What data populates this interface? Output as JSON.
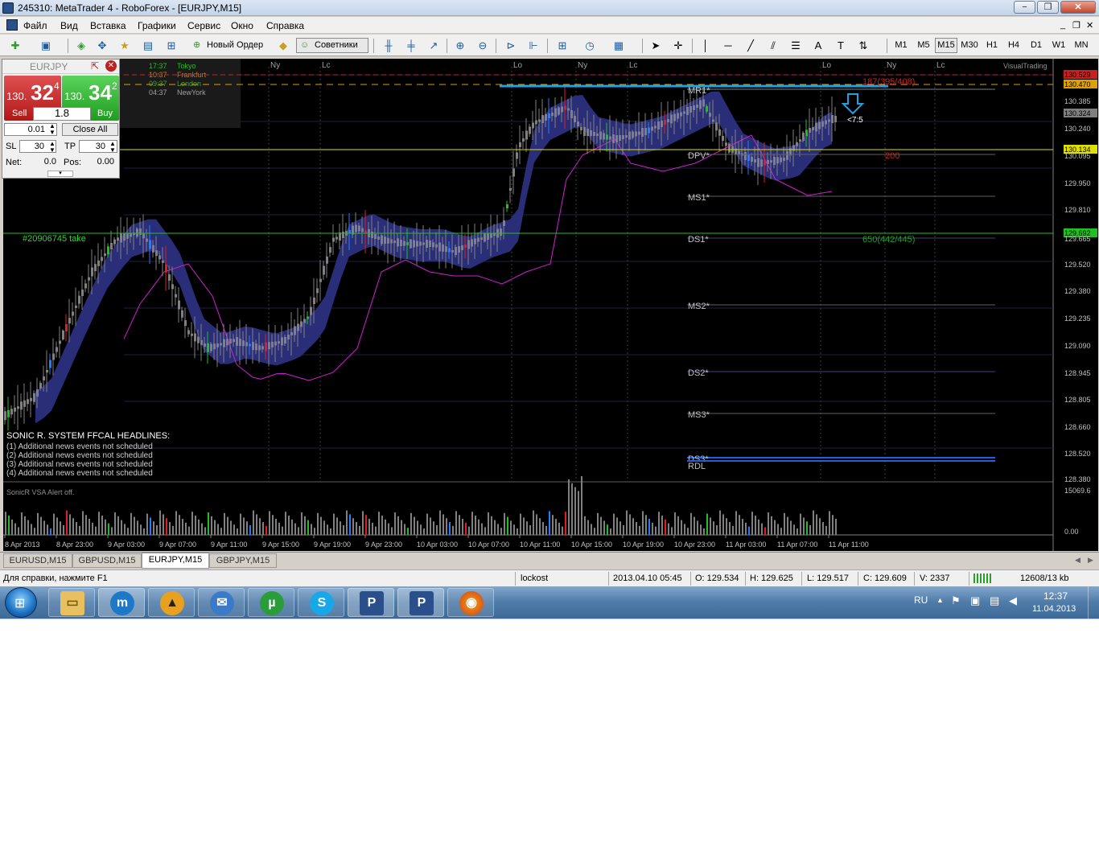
{
  "window": {
    "title": "245310: MetaTrader 4 - RoboForex - [EURJPY,M15]",
    "buttons": {
      "minimize": "−",
      "maximize": "❐",
      "close": "✕"
    }
  },
  "menu": [
    "Файл",
    "Вид",
    "Вставка",
    "Графики",
    "Сервис",
    "Окно",
    "Справка"
  ],
  "toolbar": {
    "new_order": "Новый Ордер",
    "advisors": "Советники",
    "timeframes": [
      "M1",
      "M5",
      "M15",
      "M30",
      "H1",
      "H4",
      "D1",
      "W1",
      "MN"
    ],
    "active_timeframe": "M15"
  },
  "trade_panel": {
    "symbol": "EURJPY",
    "sell": {
      "prefix": "130.",
      "big": "32",
      "sup": "4",
      "label": "Sell"
    },
    "buy": {
      "prefix": "130.",
      "big": "34",
      "sup": "2",
      "label": "Buy"
    },
    "spread": "1.8",
    "lot": "0.01",
    "close_all": "Close All",
    "sl_label": "SL",
    "sl": "30",
    "tp_label": "TP",
    "tp": "30",
    "net_label": "Net:",
    "net": "0.0",
    "pos_label": "Pos:",
    "pos": "0.00"
  },
  "sessions": [
    {
      "time": "17:37",
      "name": "Tokyo",
      "color": "#20c020"
    },
    {
      "time": "10:37",
      "name": "Frankfurt",
      "color": "#c08020"
    },
    {
      "time": "09:37",
      "name": "London",
      "color": "#40a040"
    },
    {
      "time": "04:37",
      "name": "NewYork",
      "color": "#a0a0a0"
    }
  ],
  "session_markers": [
    "Ny",
    "Lc",
    "Lo",
    "Ny",
    "Lc",
    "Lo",
    "Ny",
    "Lc"
  ],
  "watermark": "VisualTrading",
  "chart_labels": {
    "take": "#20906745  take",
    "red_line": "187(395/408)",
    "red_200": "200",
    "green_650": "650(442/445)",
    "countdown": "<7:5",
    "pivots": [
      "MR1*",
      "DPV*",
      "MS1*",
      "DS1*",
      "MS2*",
      "DS2*",
      "MS3*",
      "DS3*",
      "RDL"
    ]
  },
  "price_axis": [
    "130.529",
    "130.470",
    "130.385",
    "130.324",
    "130.240",
    "130.134",
    "130.095",
    "129.950",
    "129.810",
    "129.692",
    "129.665",
    "129.520",
    "129.380",
    "129.235",
    "129.090",
    "128.945",
    "128.805",
    "128.660",
    "128.520",
    "128.380"
  ],
  "price_axis_marked": {
    "130.529": "#cc2020",
    "130.470": "#e0a000",
    "130.134": "#e0e000",
    "129.692": "#20c020",
    "130.324": "#808080"
  },
  "time_axis": [
    "8 Apr 2013",
    "8 Apr 23:00",
    "9 Apr 03:00",
    "9 Apr 07:00",
    "9 Apr 11:00",
    "9 Apr 15:00",
    "9 Apr 19:00",
    "9 Apr 23:00",
    "10 Apr 03:00",
    "10 Apr 07:00",
    "10 Apr 11:00",
    "10 Apr 15:00",
    "10 Apr 19:00",
    "10 Apr 23:00",
    "11 Apr 03:00",
    "11 Apr 07:00",
    "11 Apr 11:00"
  ],
  "sonic_title": "SONIC R. SYSTEM  FFCAL HEADLINES:",
  "news": [
    "(1)  Additional news events not scheduled",
    "(2)  Additional news events not scheduled",
    "(3)  Additional news events not scheduled",
    "(4)  Additional news events not scheduled"
  ],
  "volume": {
    "title": "SonicR VSA   Alert off.",
    "max": "15069.6",
    "min": "0.00"
  },
  "tabs": [
    "EURUSD,M15",
    "GBPUSD,M15",
    "EURJPY,M15",
    "GBPJPY,M15"
  ],
  "active_tab": "EURJPY,M15",
  "status": {
    "help": "Для справки, нажмите F1",
    "profile": "lockost",
    "datetime": "2013.04.10 05:45",
    "open": "O: 129.534",
    "high": "H: 129.625",
    "low": "L: 129.517",
    "close": "C: 129.609",
    "volume": "V: 2337",
    "traffic": "12608/13 kb"
  },
  "taskbar": {
    "lang": "RU",
    "time": "12:37",
    "date": "11.04.2013"
  },
  "colors": {
    "band": "#2a2e78",
    "ma": "#d020d0",
    "bull": "#20c020",
    "bear": "#e02020",
    "blue_candle": "#2080ff"
  }
}
